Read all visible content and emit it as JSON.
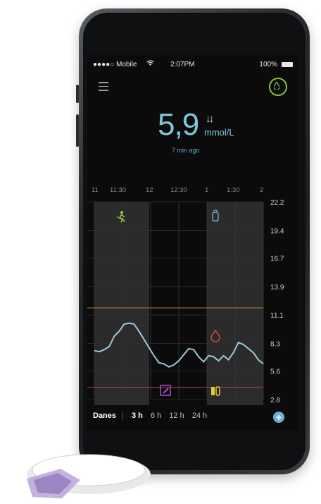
{
  "status_bar": {
    "carrier": "●●●●○ Mobile",
    "time": "2:07PM",
    "battery": "100%"
  },
  "reading": {
    "value": "5,9",
    "unit": "mmol/L",
    "trend": "↓↓",
    "ago": "7 min ago"
  },
  "time_axis": [
    "11",
    "11:30",
    "12",
    "12:30",
    "1",
    "1:30",
    "2"
  ],
  "y_ticks": [
    "22.2",
    "19.4",
    "16.7",
    "13.9",
    "11.1",
    "8.3",
    "5.6",
    "2.8"
  ],
  "ranges": {
    "bottom_label": "Danes",
    "options": [
      "3 h",
      "6 h",
      "12 h",
      "24 h"
    ],
    "selected": "3 h"
  },
  "colors": {
    "accent": "#7fc6da",
    "high_line": "#d08a2a",
    "low_line": "#c83a4a",
    "exercise_icon": "#9ec64a",
    "insulin_icon": "#6fbfd6",
    "note_icon": "#b04ad0",
    "food_icon": "#e0d02a",
    "blood_drop_icon": "#d04a3a",
    "drop_button": "#8bbf3a"
  },
  "chart_data": {
    "type": "line",
    "x": [
      "11:00",
      "11:05",
      "11:10",
      "11:15",
      "11:20",
      "11:25",
      "11:30",
      "11:35",
      "11:40",
      "11:45",
      "11:50",
      "11:55",
      "12:00",
      "12:05",
      "12:10",
      "12:15",
      "12:20",
      "12:25",
      "12:30",
      "12:35",
      "12:40",
      "12:45",
      "12:50",
      "12:55",
      "1:00",
      "1:05",
      "1:10",
      "1:15",
      "1:20",
      "1:25",
      "1:30",
      "1:35",
      "1:40",
      "1:45",
      "1:50"
    ],
    "y": [
      7.6,
      7.5,
      7.7,
      8.0,
      9.0,
      9.5,
      10.2,
      10.3,
      10.2,
      9.5,
      8.7,
      7.9,
      7.1,
      6.4,
      6.3,
      6.0,
      6.2,
      6.6,
      7.2,
      7.8,
      7.7,
      7.0,
      6.5,
      7.1,
      7.0,
      6.6,
      7.1,
      6.7,
      7.4,
      8.4,
      8.2,
      7.8,
      7.4,
      6.7,
      6.3
    ],
    "ylim": [
      2.8,
      22.2
    ],
    "thresholds": {
      "high": 11.8,
      "low": 4.0
    }
  }
}
